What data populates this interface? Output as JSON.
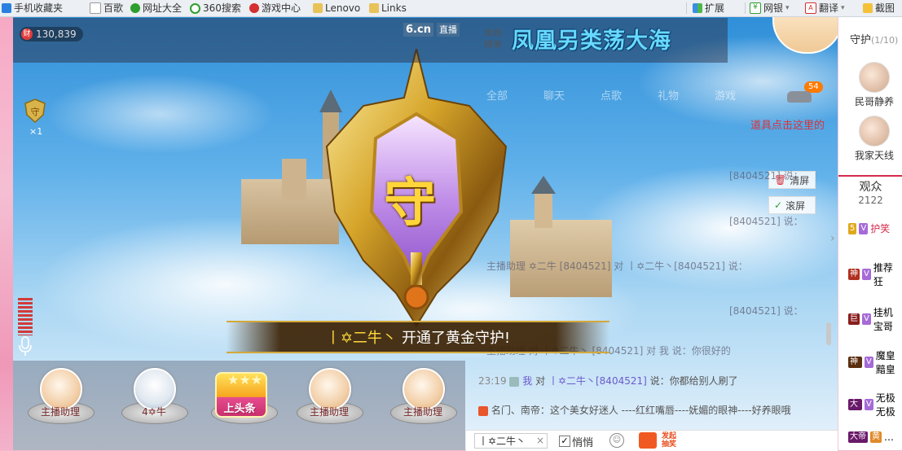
{
  "bookmarks": [
    {
      "label": "手机收藏夹",
      "icon": "phone-icon",
      "color": "#2a80e0"
    },
    {
      "label": "百歌",
      "icon": "page-icon",
      "color": "#888888"
    },
    {
      "label": "网址大全",
      "icon": "hao-icon",
      "color": "#2e9e2e"
    },
    {
      "label": "360搜索",
      "icon": "search-360-icon",
      "color": "#2e9e2e"
    },
    {
      "label": "游戏中心",
      "icon": "game-center-icon",
      "color": "#d43030"
    },
    {
      "label": "Lenovo",
      "icon": "folder-icon",
      "color": "#e8c35a"
    },
    {
      "label": "Links",
      "icon": "folder-icon",
      "color": "#e8c35a"
    }
  ],
  "browser_tools": {
    "extensions": "扩展",
    "netbank": "网银",
    "translate": "翻译",
    "screenshot": "截图"
  },
  "stream": {
    "wealth": "130,839",
    "site_logo": "6.cn",
    "live_tag": "直播",
    "rank_label": "本场榜单",
    "room_title": "凤凰另类荡大海",
    "guard_count": "×1",
    "car_badge": "54"
  },
  "banner": {
    "user": "丨✡二牛丶",
    "message": "开通了黄金守护!"
  },
  "guard_emblem": {
    "glyph": "守"
  },
  "seats": [
    {
      "label": "主播助理"
    },
    {
      "label": "4✡牛"
    },
    {
      "label": "上头条"
    },
    {
      "label": "主播助理"
    },
    {
      "label": "主播助理"
    }
  ],
  "chat": {
    "tabs": [
      "全部",
      "聊天",
      "点歌",
      "礼物",
      "游戏"
    ],
    "props_hint": "道具点击这里的",
    "clear_label": "清屏",
    "scroll_label": "滚屏",
    "ghost_lines": [
      "[8404521] 说：",
      "主播助理 ✡二牛 [8404521] 对 丨✡二牛丶[8404521] 说：",
      "[8404521] 说：",
      "[8404521] 说：",
      "主播助理 对 丨✡二牛丶 [8404521] 对 我 说：你很好的"
    ],
    "last_line": {
      "time": "23:19",
      "me": "我",
      "to": "对",
      "target": "丨✡二牛丶[8404521]",
      "text": "说：你都给别人刷了"
    },
    "announce": "名门、南帝：这个美女好迷人 ----红红嘴唇----妩媚的眼神----好养眼哦"
  },
  "input": {
    "target": "丨✡二牛丶",
    "close": "×",
    "quiet_label": "悄悄",
    "lottery_label": "发起抽奖"
  },
  "rightpane": {
    "guard_title": "守护",
    "guard_count": "(1/10)",
    "guards": [
      {
        "name": "民哥静养"
      },
      {
        "name": "我家天线"
      }
    ],
    "audience_title": "观众",
    "audience_count": "2122",
    "audience_rows": [
      {
        "tag": "5",
        "badge": "V",
        "name": "护笑"
      },
      {
        "tag": "神",
        "badge": "V",
        "name": "推荐 狂"
      },
      {
        "tag": "巨",
        "badge": "V",
        "name": "挂机 宝哥"
      },
      {
        "tag": "神之",
        "badge": "V",
        "name": "魔皇 黯皇"
      },
      {
        "tag": "大帝",
        "badge": "V",
        "name": "无极 无极"
      },
      {
        "tag": "大帝",
        "badge": "黄",
        "name": "…"
      }
    ]
  }
}
